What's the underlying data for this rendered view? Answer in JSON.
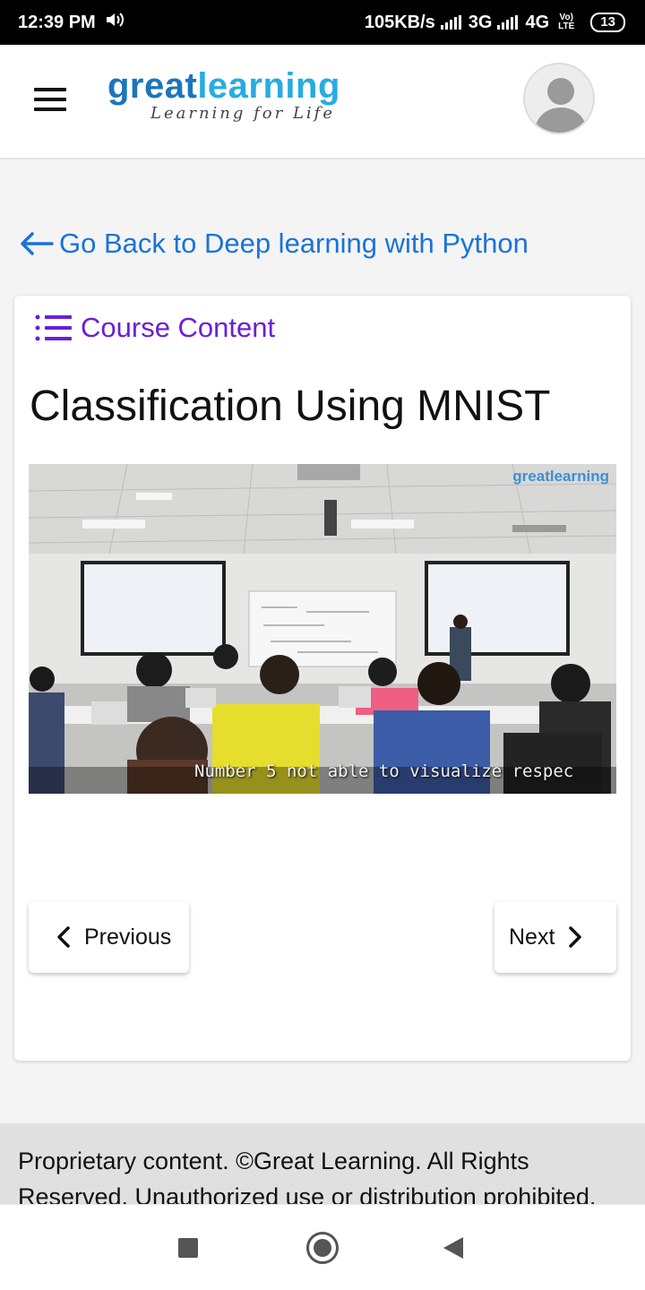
{
  "status_bar": {
    "time": "12:39 PM",
    "network_speed": "105KB/s",
    "net1": "3G",
    "net2": "4G",
    "volte_top": "Vo)",
    "volte_bottom": "LTE",
    "battery": "13"
  },
  "header": {
    "logo_part1": "great",
    "logo_part2": "learning",
    "tagline": "Learning for Life",
    "menu_icon": "hamburger-icon",
    "avatar_icon": "user-avatar-icon"
  },
  "back_link": {
    "label": "Go Back to Deep learning with Python",
    "icon": "arrow-left-icon"
  },
  "card": {
    "course_content_label": "Course Content",
    "course_content_icon": "list-icon",
    "lesson_title": "Classification Using MNIST",
    "video": {
      "watermark": "greatlearning",
      "caption": "Number 5 not able to visualize respec"
    },
    "prev_label": "Previous",
    "next_label": "Next"
  },
  "footer": {
    "text": "Proprietary content. ©Great Learning. All Rights Reserved. Unauthorized use or distribution prohibited."
  },
  "colors": {
    "link_blue": "#1a73d9",
    "course_purple": "#6a1fd6",
    "logo_dark_blue": "#1c75bc",
    "logo_light_blue": "#29abe2"
  }
}
